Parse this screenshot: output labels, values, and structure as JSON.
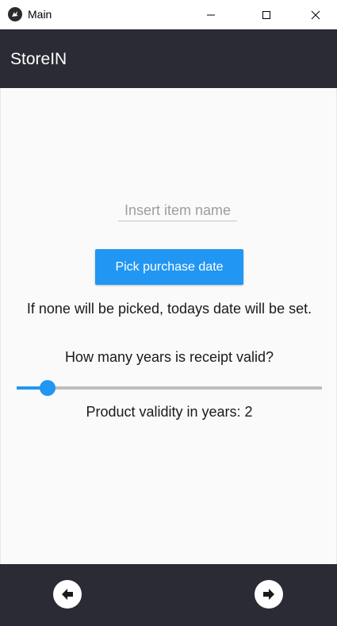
{
  "window": {
    "title": "Main",
    "icons": {
      "app": "kivy-logo-icon",
      "minimize": "minimize-icon",
      "maximize": "maximize-icon",
      "close": "close-icon"
    }
  },
  "appbar": {
    "title": "StoreIN"
  },
  "form": {
    "item_name_value": "",
    "item_name_placeholder": "Insert item name",
    "pick_date_label": "Pick purchase date",
    "hint": "If none will be picked, todays date will be set.",
    "question": "How many years is receipt valid?",
    "slider": {
      "value": 2,
      "min": 0,
      "max": 20,
      "color": "#2196f3"
    },
    "validity_text": "Product validity in years: 2"
  },
  "bottombar": {
    "prev_icon": "arrow-left-circle-icon",
    "next_icon": "arrow-right-circle-icon"
  },
  "colors": {
    "bar_background": "#2b2b35",
    "accent": "#2196f3",
    "content_background": "#fafafa"
  }
}
